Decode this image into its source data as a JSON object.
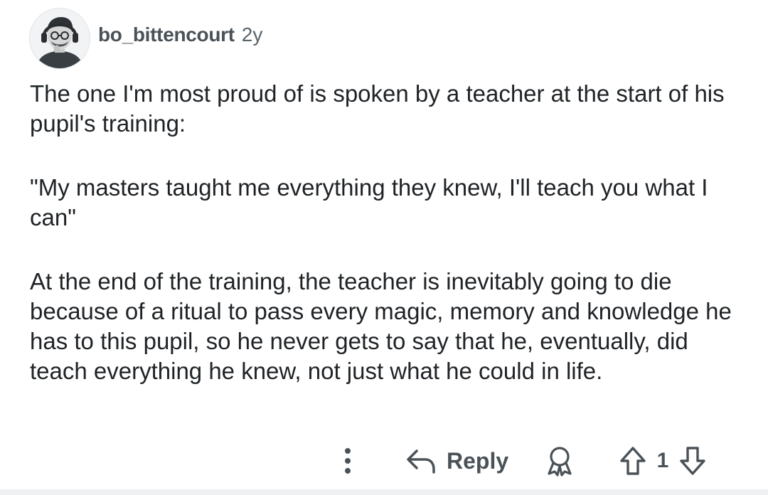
{
  "comment": {
    "username": "bo_bittencourt",
    "age": "2y",
    "paragraphs": [
      "The one I'm most proud of is spoken by a teacher at the start of his pupil's training:",
      "\"My masters taught me everything they knew, I'll teach you what I can\"",
      "At the end of the training, the teacher is inevitably going to die because of a ritual to pass every magic, memory and knowledge he has to this pupil, so he never gets to say that he, eventually, did teach everything he knew, not just what he could in life."
    ]
  },
  "actions": {
    "more_icon": "more-vertical-icon",
    "reply_icon": "reply-arrow-icon",
    "reply_label": "Reply",
    "award_icon": "award-icon",
    "upvote_icon": "upvote-arrow-icon",
    "vote_count": "1",
    "downvote_icon": "downvote-arrow-icon"
  },
  "colors": {
    "text": "#1f2326",
    "muted": "#4a5258",
    "background": "#ffffff"
  }
}
